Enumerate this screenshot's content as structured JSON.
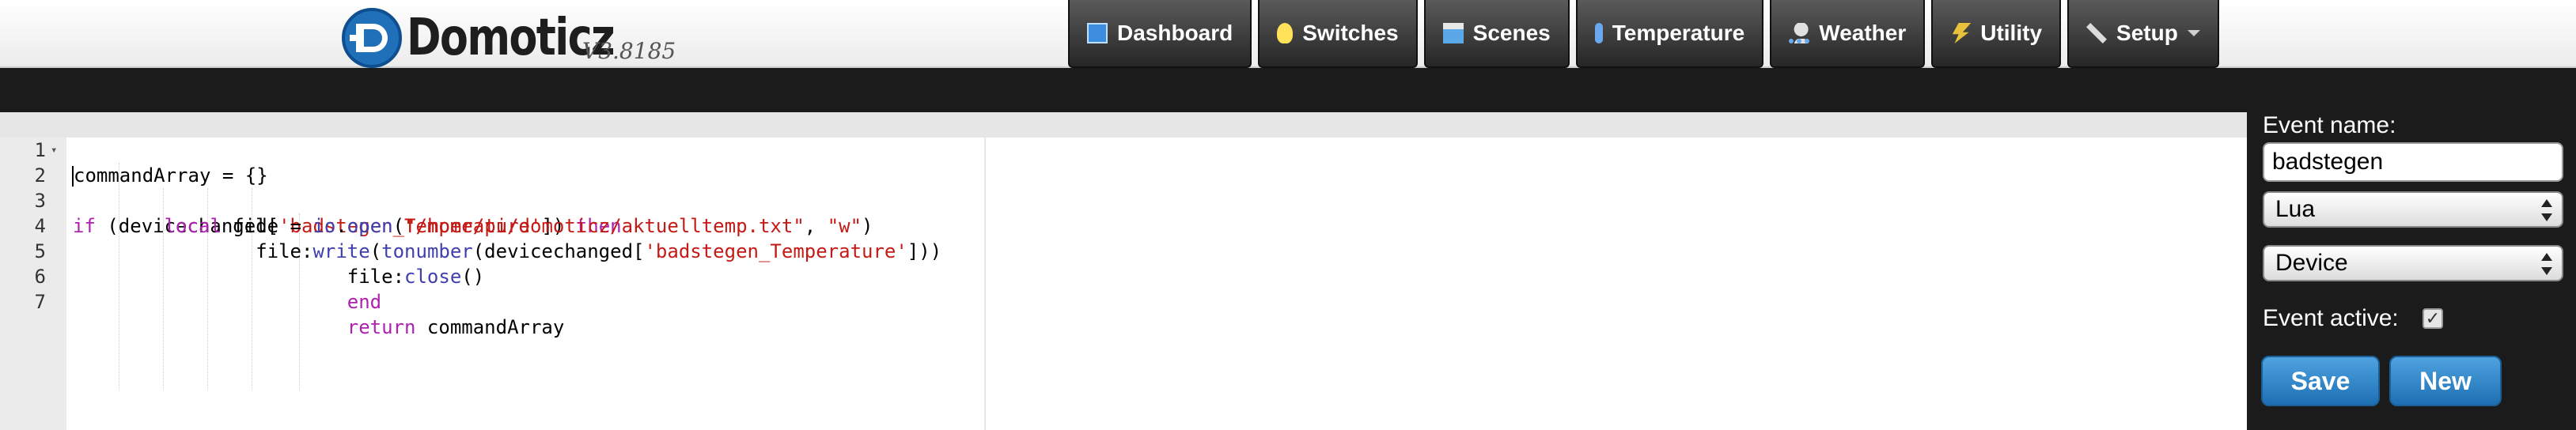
{
  "header": {
    "logo_text": "Domoticz",
    "version": "V3.8185"
  },
  "nav": {
    "items": [
      {
        "label": "Dashboard",
        "icon": "dashboard-icon"
      },
      {
        "label": "Switches",
        "icon": "lightbulb-icon"
      },
      {
        "label": "Scenes",
        "icon": "scenes-icon"
      },
      {
        "label": "Temperature",
        "icon": "thermometer-icon"
      },
      {
        "label": "Weather",
        "icon": "weather-icon"
      },
      {
        "label": "Utility",
        "icon": "lightning-icon"
      },
      {
        "label": "Setup",
        "icon": "tools-icon"
      }
    ]
  },
  "editor": {
    "language": "Lua",
    "lines": [
      {
        "n": "1",
        "text": "commandArray = {}"
      },
      {
        "n": "2",
        "text": "if (devicechanged['badstegen_Temperature']) then"
      },
      {
        "n": "3",
        "text": "        local file = io.open(\"/home/pi/domoticz/aktuelltemp.txt\", \"w\")"
      },
      {
        "n": "4",
        "text": "                file:write(tonumber(devicechanged['badstegen_Temperature']))"
      },
      {
        "n": "5",
        "text": "                        file:close()"
      },
      {
        "n": "6",
        "text": "                        end"
      },
      {
        "n": "7",
        "text": "                        return commandArray"
      }
    ]
  },
  "panel": {
    "event_name_label": "Event name:",
    "event_name_value": "badstegen",
    "language_select": "Lua",
    "type_select": "Device",
    "event_active_label": "Event active:",
    "event_active_checked": true,
    "save_label": "Save",
    "new_label": "New"
  },
  "colors": {
    "button_blue": "#1d6fb3",
    "nav_dark": "#262626",
    "keyword": "#b020b0",
    "string": "#c41a16"
  }
}
